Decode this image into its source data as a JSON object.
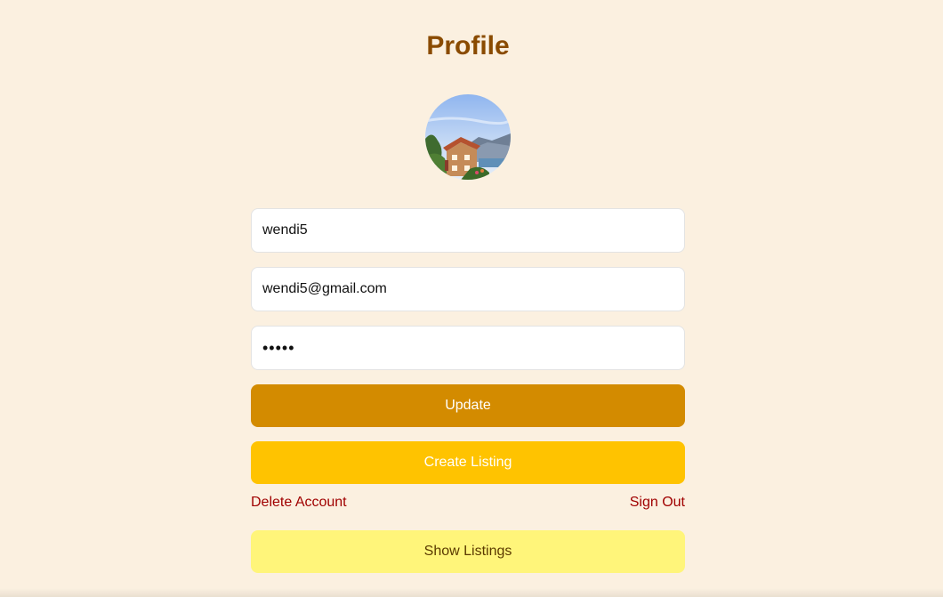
{
  "page": {
    "title": "Profile"
  },
  "avatar": {
    "alt": "profile avatar"
  },
  "form": {
    "username_value": "wendi5",
    "email_value": "wendi5@gmail.com",
    "password_value": "•••••"
  },
  "buttons": {
    "update_label": "Update",
    "create_listing_label": "Create Listing",
    "show_listings_label": "Show Listings"
  },
  "links": {
    "delete_account_label": "Delete Account",
    "sign_out_label": "Sign Out"
  },
  "colors": {
    "background": "#fbf0e0",
    "title": "#8a4b00",
    "update_button": "#d38b00",
    "create_listing_button": "#ffc300",
    "show_listings_button": "#fff57a",
    "danger_link": "#a00000"
  }
}
